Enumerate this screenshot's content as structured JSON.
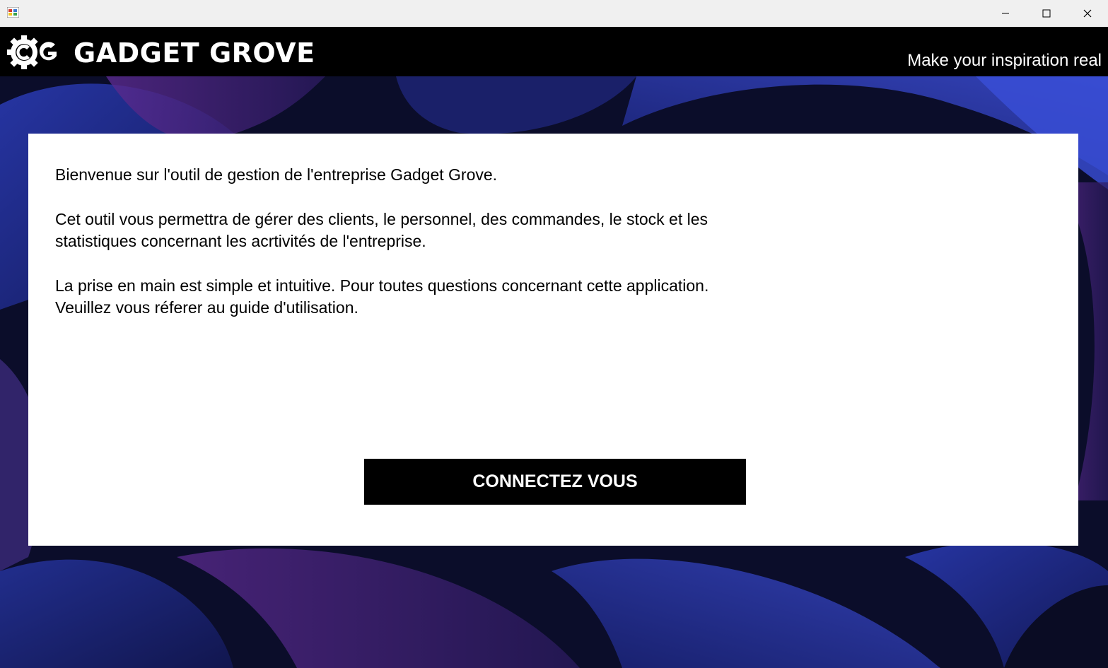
{
  "window": {
    "controls": {
      "minimize_icon": "minimize-icon",
      "maximize_icon": "maximize-icon",
      "close_icon": "close-icon"
    }
  },
  "header": {
    "brand_name": "GADGET GROVE",
    "tagline": "Make your inspiration real",
    "logo_icon": "gear-g-logo"
  },
  "panel": {
    "welcome": "Bienvenue sur l'outil de gestion de l'entreprise Gadget Grove.",
    "description_line1": "Cet outil vous permettra de gérer des clients, le personnel, des commandes, le stock et les",
    "description_line2": "statistiques concernant les acrtivités de l'entreprise.",
    "help_line1": "La prise en main est simple et intuitive. Pour toutes questions concernant cette application.",
    "help_line2": "Veuillez vous réferer au guide d'utilisation.",
    "connect_button": "CONNECTEZ VOUS"
  },
  "colors": {
    "header_bg": "#000000",
    "panel_bg": "#ffffff",
    "button_bg": "#000000",
    "button_text": "#ffffff",
    "background_deep": "#0b0d2a",
    "background_blue": "#1f2a8a",
    "background_purple": "#5a2a8a"
  }
}
